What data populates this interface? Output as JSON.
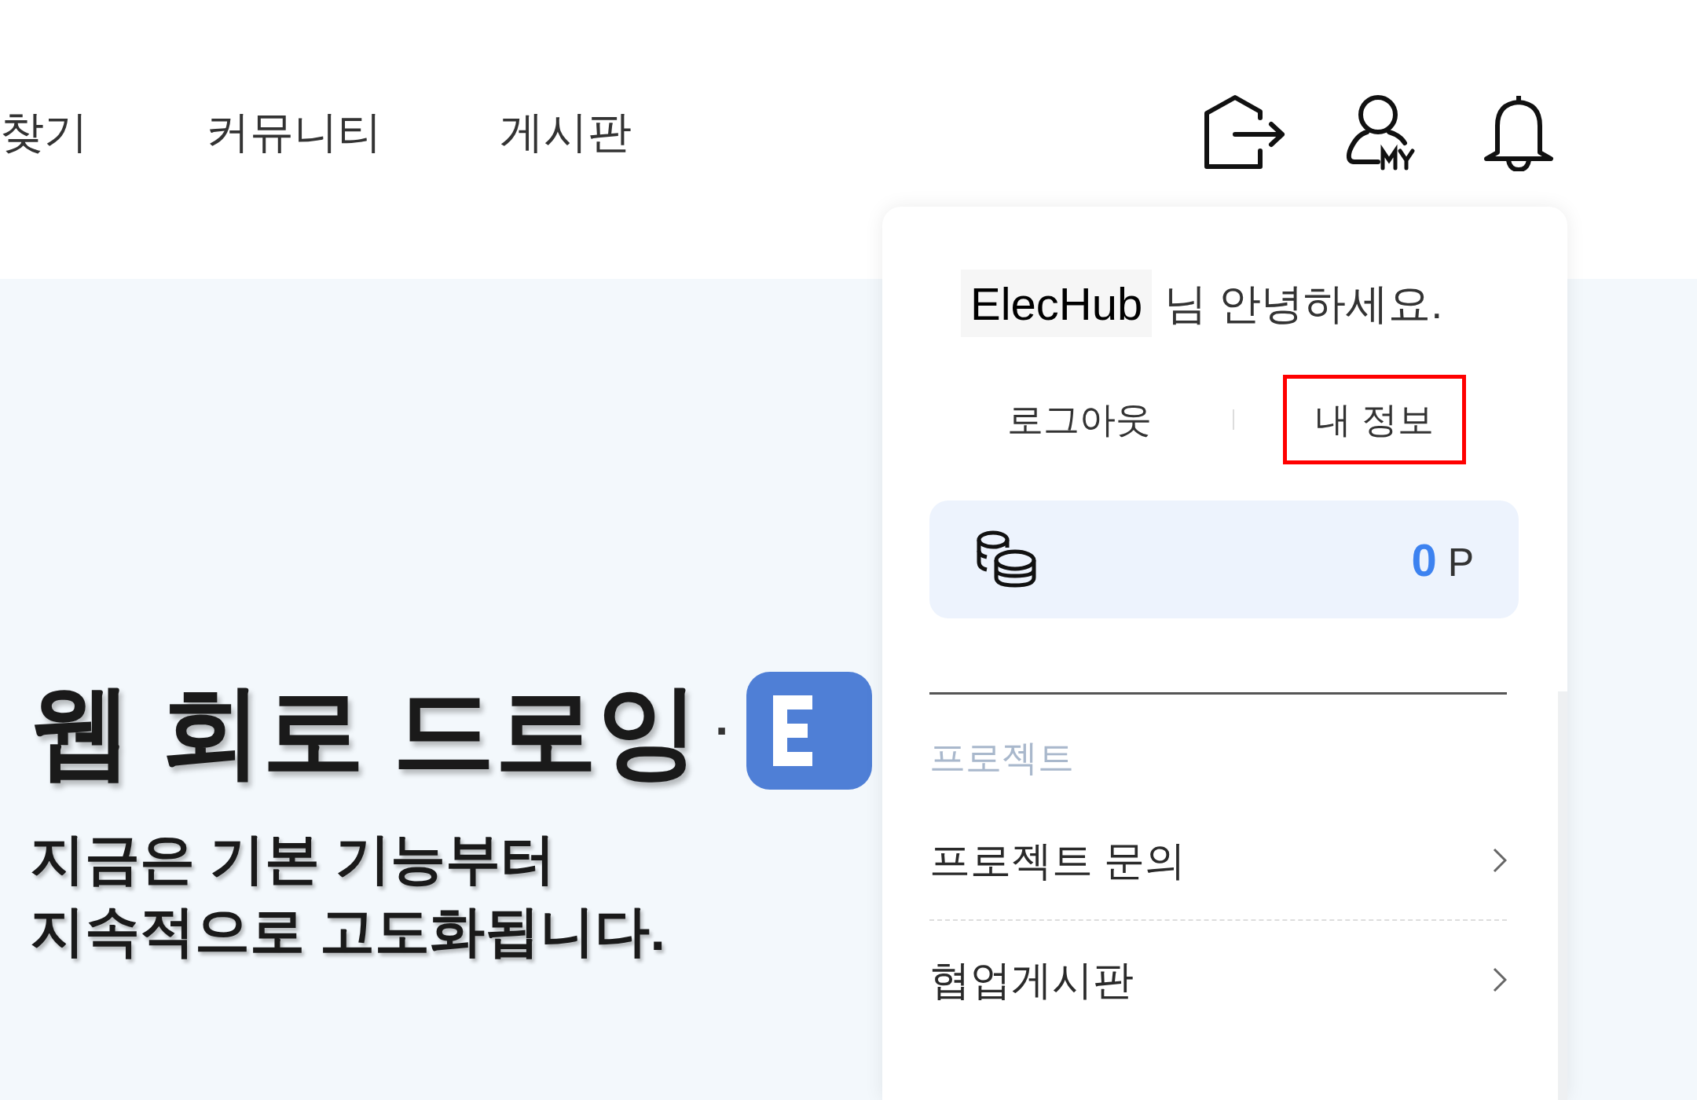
{
  "nav": {
    "items": [
      {
        "label": "찾기"
      },
      {
        "label": "커뮤니티"
      },
      {
        "label": "게시판"
      }
    ]
  },
  "hero": {
    "title": "웹 회로 드로잉",
    "separator": "·",
    "subtitle_lines": [
      "지금은 기본 기능부터",
      "지속적으로 고도화됩니다."
    ]
  },
  "account_menu": {
    "username": "ElecHub",
    "greeting": "님 안녕하세요.",
    "links": [
      {
        "label": "로그아웃",
        "highlighted": false
      },
      {
        "label": "내 정보",
        "highlighted": true
      }
    ],
    "points": {
      "value": "0",
      "unit": "P"
    },
    "sections": [
      {
        "heading": "프로젝트",
        "items": [
          {
            "label": "프로젝트 문의"
          },
          {
            "label": "협업게시판"
          }
        ]
      }
    ]
  }
}
